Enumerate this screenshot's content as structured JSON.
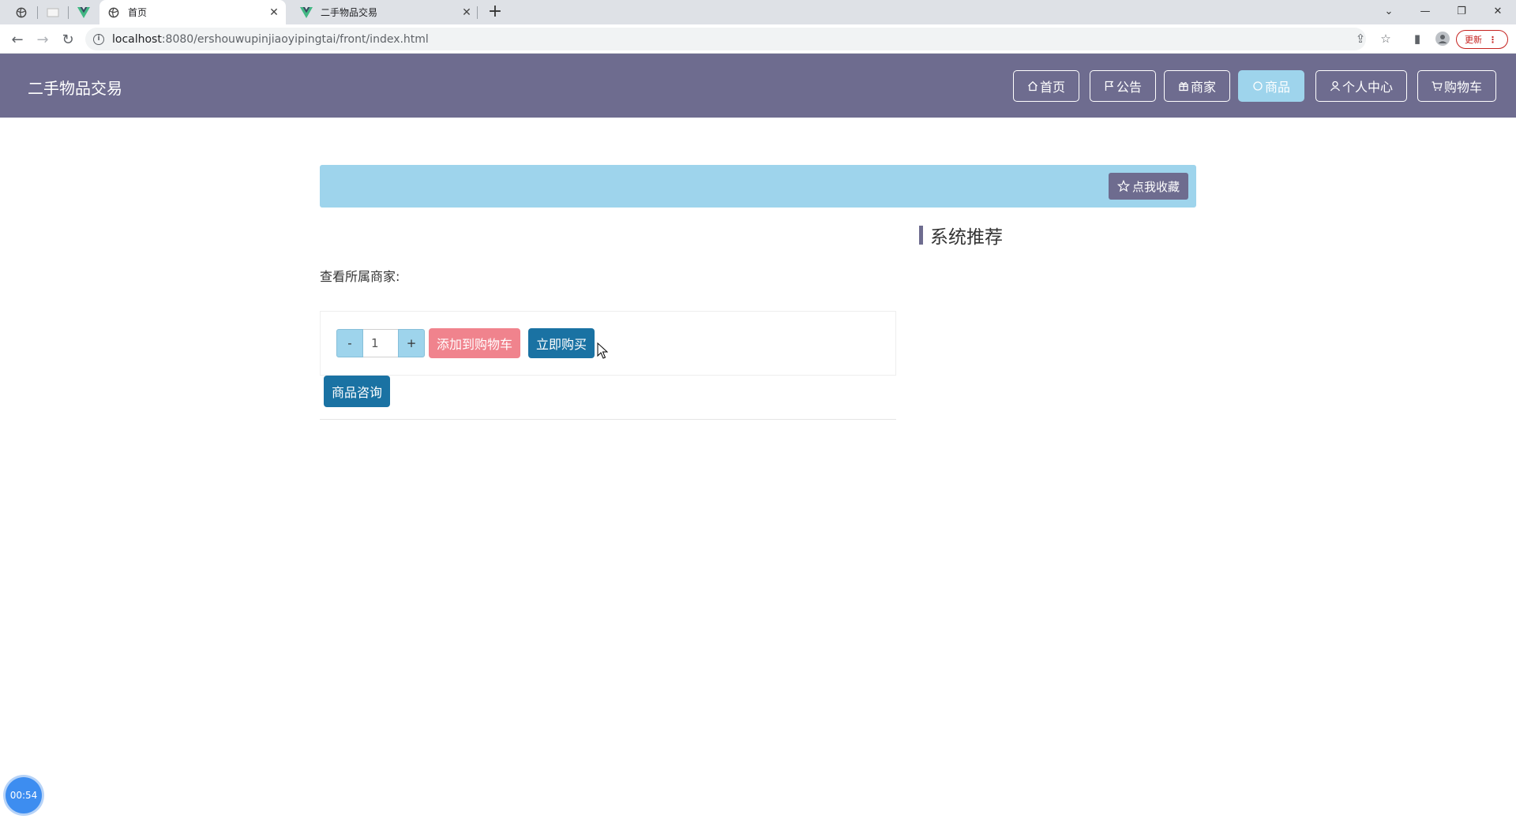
{
  "browser": {
    "tabs": [
      {
        "title": "首页",
        "icon": "globe-icon",
        "active": true
      },
      {
        "title": "二手物品交易",
        "icon": "vue-icon",
        "active": false
      }
    ],
    "url_host": "localhost",
    "url_path": ":8080/ershouwupinjiaoyipingtai/front/index.html",
    "update_label": "更新"
  },
  "header": {
    "site_title": "二手物品交易",
    "nav": [
      {
        "label": "首页",
        "icon": "home-icon"
      },
      {
        "label": "公告",
        "icon": "flag-icon"
      },
      {
        "label": "商家",
        "icon": "gift-icon"
      },
      {
        "label": "商品",
        "icon": "circle-icon",
        "active": true
      },
      {
        "label": "个人中心",
        "icon": "user-icon"
      },
      {
        "label": "购物车",
        "icon": "cart-icon"
      }
    ]
  },
  "banner": {
    "favorite_label": "点我收藏"
  },
  "recommend": {
    "title": "系统推荐"
  },
  "product": {
    "merchant_label": "查看所属商家:",
    "qty_minus": "-",
    "quantity": "1",
    "qty_plus": "+",
    "add_to_cart": "添加到购物车",
    "buy_now": "立即购买",
    "consult": "商品咨询"
  },
  "timer": {
    "value": "00:54"
  },
  "colors": {
    "header_bg": "#6e6c8f",
    "accent_light": "#9ed4ec",
    "primary_btn": "#1a72a3",
    "cart_btn": "#f0838d"
  }
}
